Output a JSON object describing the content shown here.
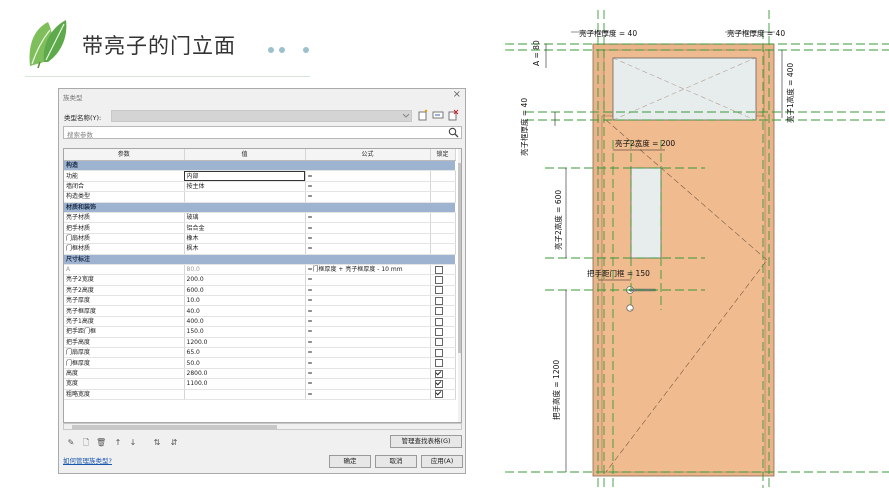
{
  "slide": {
    "title": "带亮子的门立面"
  },
  "dialog": {
    "title": "族类型",
    "type_name_label": "类型名称(Y):",
    "search_placeholder": "搜索参数",
    "columns": [
      "参数",
      "值",
      "公式",
      "锁定"
    ],
    "groups": [
      {
        "name": "构造",
        "rows": [
          {
            "param": "功能",
            "value": "内部",
            "formula": "=",
            "lock": null
          },
          {
            "param": "墙闭合",
            "value": "按主体",
            "formula": "=",
            "lock": null
          },
          {
            "param": "构造类型",
            "value": "",
            "formula": "=",
            "lock": null
          }
        ]
      },
      {
        "name": "材质和装饰",
        "rows": [
          {
            "param": "亮子材质",
            "value": "玻璃",
            "formula": "=",
            "lock": null
          },
          {
            "param": "把手材质",
            "value": "铝合金",
            "formula": "=",
            "lock": null
          },
          {
            "param": "门扇材质",
            "value": "橡木",
            "formula": "=",
            "lock": null
          },
          {
            "param": "门框材质",
            "value": "枫木",
            "formula": "=",
            "lock": null
          }
        ]
      },
      {
        "name": "尺寸标注",
        "rows": [
          {
            "param": "A",
            "value": "80.0",
            "formula": "=门框厚度 + 亮子框厚度 - 10 mm",
            "lock": false,
            "greyed": true
          },
          {
            "param": "亮子2宽度",
            "value": "200.0",
            "formula": "=",
            "lock": false
          },
          {
            "param": "亮子2高度",
            "value": "600.0",
            "formula": "=",
            "lock": false
          },
          {
            "param": "亮子厚度",
            "value": "10.0",
            "formula": "=",
            "lock": false
          },
          {
            "param": "亮子框厚度",
            "value": "40.0",
            "formula": "=",
            "lock": false
          },
          {
            "param": "亮子1高度",
            "value": "400.0",
            "formula": "=",
            "lock": false
          },
          {
            "param": "把手距门框",
            "value": "150.0",
            "formula": "=",
            "lock": false
          },
          {
            "param": "把手高度",
            "value": "1200.0",
            "formula": "=",
            "lock": false
          },
          {
            "param": "门扇厚度",
            "value": "65.0",
            "formula": "=",
            "lock": false
          },
          {
            "param": "门框厚度",
            "value": "50.0",
            "formula": "=",
            "lock": false
          },
          {
            "param": "高度",
            "value": "2800.0",
            "formula": "=",
            "lock": true
          },
          {
            "param": "宽度",
            "value": "1100.0",
            "formula": "=",
            "lock": true
          },
          {
            "param": "粗略宽度",
            "value": "",
            "formula": "=",
            "lock": true
          }
        ]
      }
    ],
    "manage_button": "管理查找表格(G)",
    "help_link": "如何管理族类型?",
    "ok_button": "确定",
    "cancel_button": "取消",
    "apply_button": "应用(A)"
  },
  "drawing": {
    "labels": {
      "frame_thickness_left": "亮子框厚度 = 40",
      "frame_thickness_right": "亮子框厚度 = 40",
      "a_dim": "A = 80",
      "frame_thickness_vertical": "亮子框厚度 = 40",
      "transom1_height": "亮子1高度 = 400",
      "transom2_width": "亮子2宽度 = 200",
      "transom2_height": "亮子2高度 = 600",
      "handle_offset": "把手距门框 = 150",
      "handle_height": "把手高度 = 1200"
    },
    "colors": {
      "door_fill": "#efbb8f",
      "frame_fill": "#e9b48a",
      "glass_fill": "#e7ecec",
      "reference_line": "#3a9a3a"
    }
  }
}
